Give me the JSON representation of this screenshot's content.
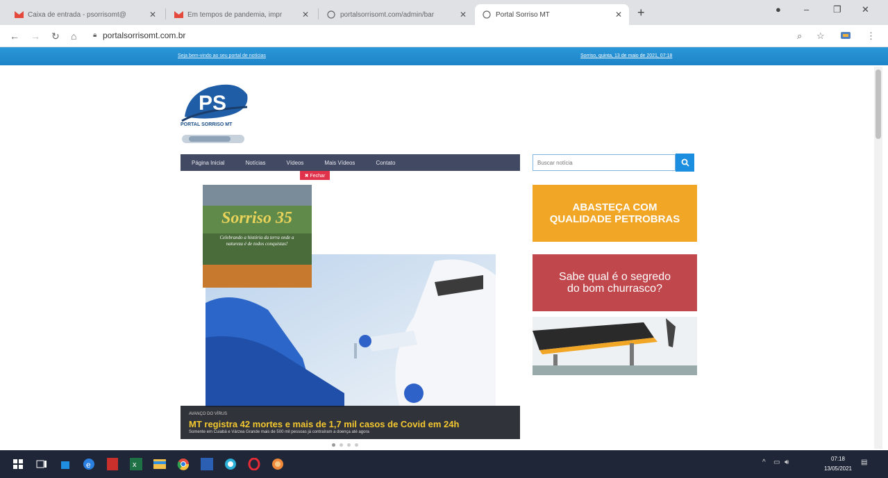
{
  "browser": {
    "tabs": [
      {
        "title": "Caixa de entrada - psorrisomt@",
        "icon": "gmail-icon"
      },
      {
        "title": "Em tempos de pandemia, impr",
        "icon": "gmail-icon"
      },
      {
        "title": "portalsorrisomt.com/admin/bar",
        "icon": "globe-icon"
      },
      {
        "title": "Portal Sorriso MT",
        "icon": "globe-icon"
      }
    ],
    "url": "portalsorrisomt.com.br"
  },
  "site": {
    "welcome": "Seja bem-vindo ao seu portal de notícias",
    "date": "Sorriso, quinta, 13 de maio de 2021, 07:18",
    "logo_name": "PORTAL SORRISO MT",
    "logo_letters": "PS",
    "nav": [
      "Página Inicial",
      "Notícias",
      "Vídeos",
      "Mais Vídeos",
      "Contato"
    ],
    "close_label": "✖ Fechar",
    "search_placeholder": "Buscar notícia",
    "slide": {
      "kicker": "AVANÇO DO VÍRUS",
      "headline": "MT registra 42 mortes e mais de 1,7 mil casos de Covid em 24h",
      "sub": "Somente em Cuiabá e Várzea Grande mais de 500 mil pessoas já contraíram a doença até agora"
    },
    "promo": {
      "title": "Sorriso 35",
      "text": "Celebrando a história da terra onde a natureza é de todos conquistas!"
    },
    "ads": {
      "ad1_line1": "ABASTEÇA COM",
      "ad1_line2": "QUALIDADE PETROBRAS",
      "ad2_line1": "Sabe qual é o segredo",
      "ad2_line2": "do bom churrasco?"
    }
  },
  "taskbar": {
    "time": "07:18",
    "date": "13/05/2021"
  }
}
